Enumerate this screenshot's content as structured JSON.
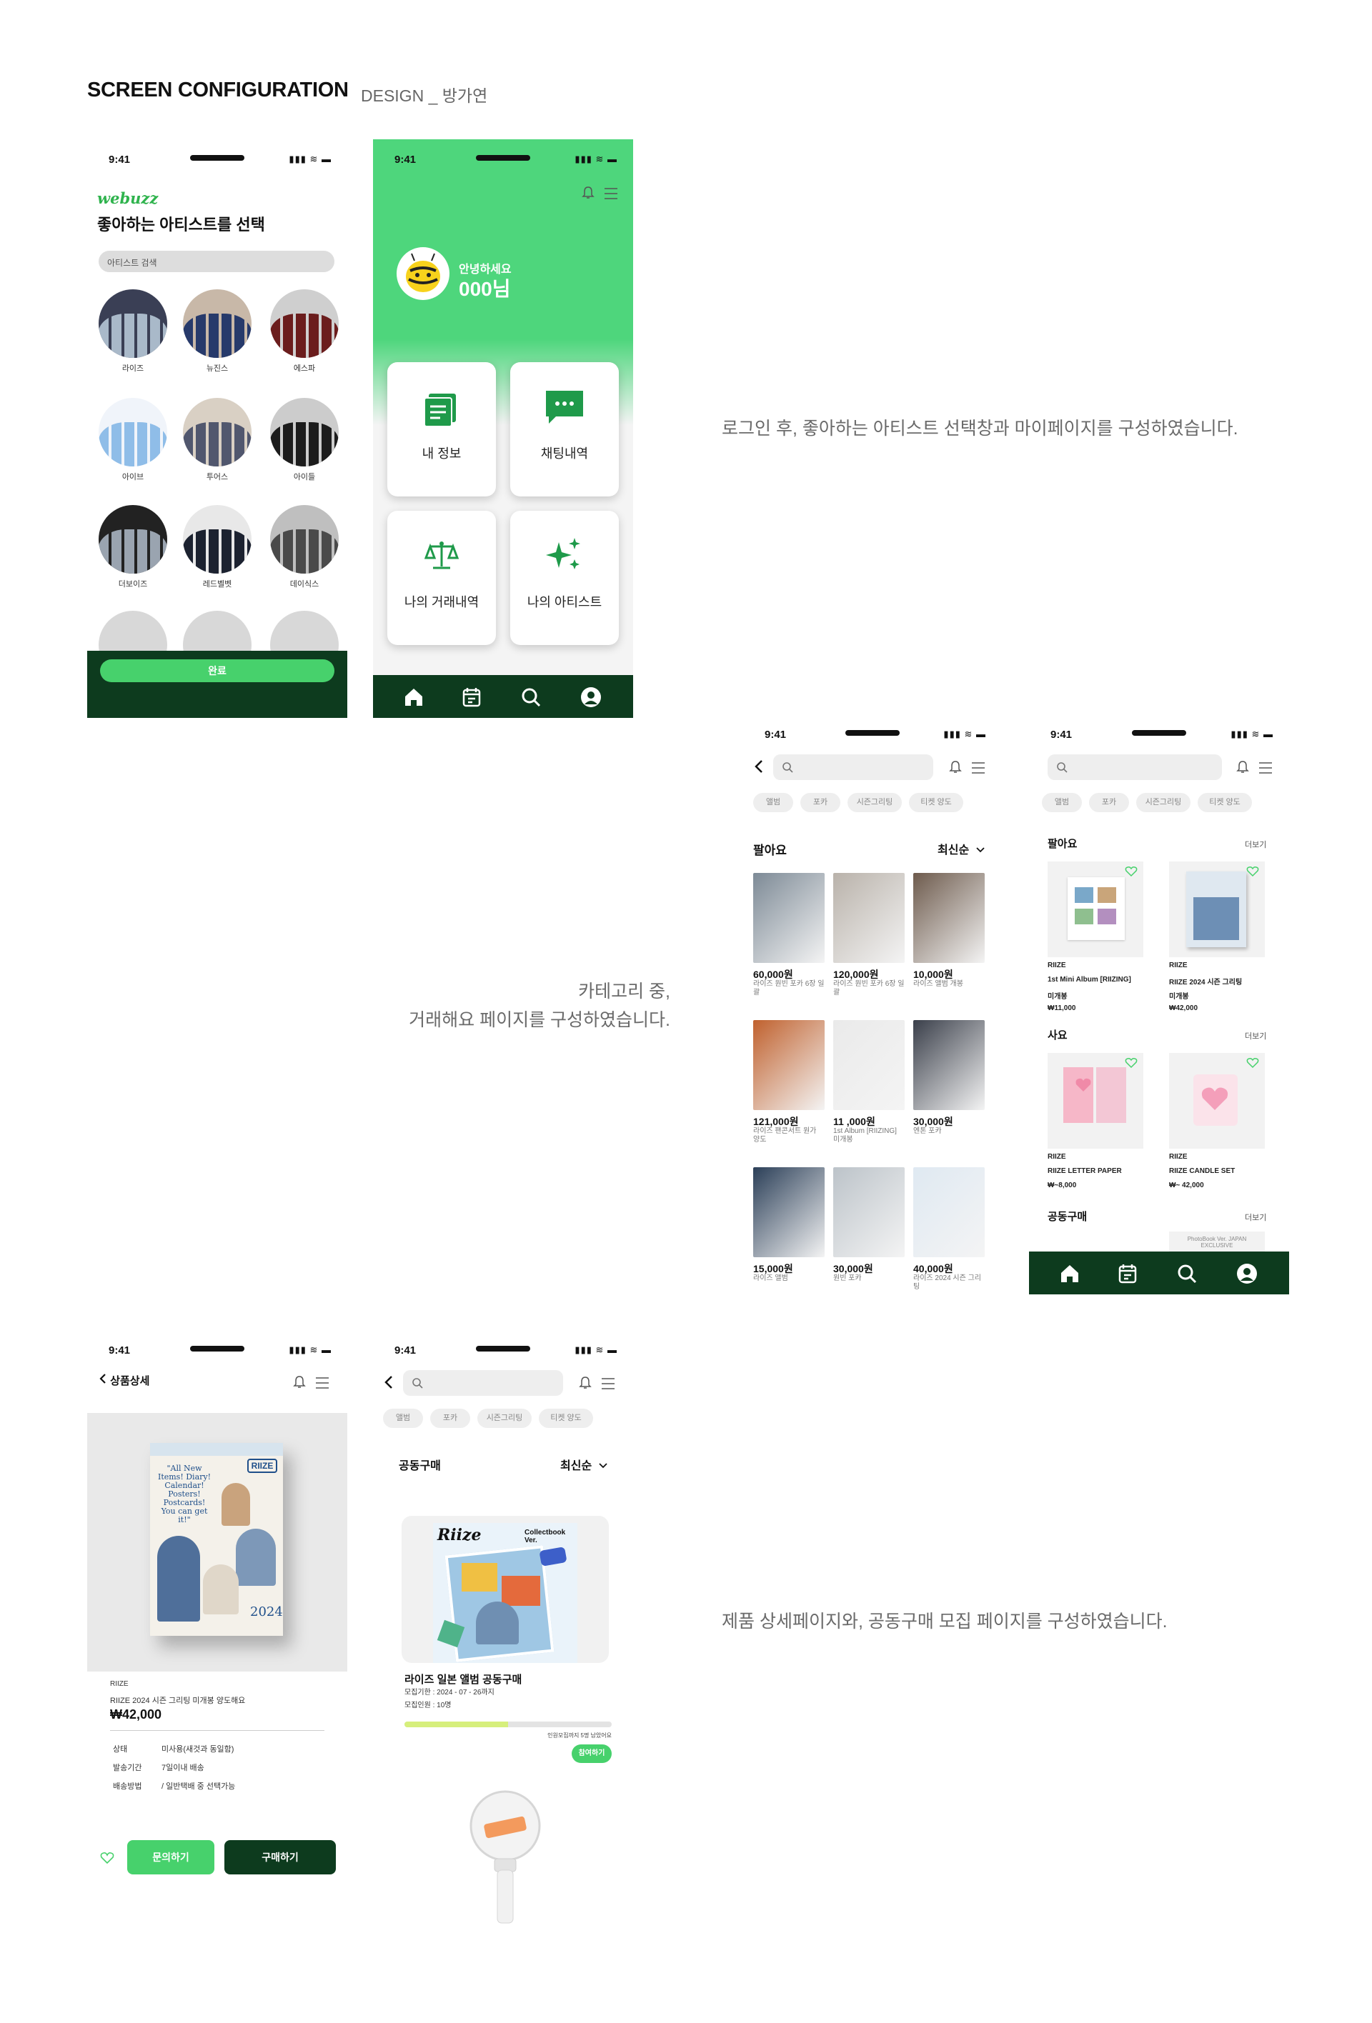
{
  "header": {
    "title": "SCREEN CONFIGURATION",
    "subtitle": "DESIGN _ 방가연"
  },
  "descriptions": {
    "d1": "로그인 후, 좋아하는 아티스트 선택창과 마이페이지를 구성하였습니다.",
    "d2a": "카테고리 중,",
    "d2b": "거래해요 페이지를 구성하였습니다.",
    "d3": "제품 상세페이지와, 공동구매 모집 페이지를 구성하였습니다."
  },
  "status": {
    "time": "9:41",
    "indicators": "▮▮▮ ≋ ▬"
  },
  "colors": {
    "green": "#47d16c",
    "dark": "#0d3b1e",
    "iconGreen": "#1f9a4a"
  },
  "select": {
    "logo": "webuzz",
    "title": "좋아하는 아티스트를 선택",
    "search_placeholder": "아티스트 검색",
    "artists": [
      "라이즈",
      "뉴진스",
      "에스파",
      "아이브",
      "투어스",
      "아이들",
      "더보이즈",
      "레드벨벳",
      "데이식스"
    ],
    "done": "완료"
  },
  "mypage": {
    "greeting": "안녕하세요",
    "name": "000님",
    "cards": [
      "내 정보",
      "채팅내역",
      "나의 거래내역",
      "나의 아티스트"
    ]
  },
  "categories": [
    "앨범",
    "포카",
    "시즌그리팅",
    "티켓 양도"
  ],
  "sell": {
    "title": "팔아요",
    "sort": "최신순",
    "items": [
      {
        "price": "60,000원",
        "desc": "라이즈 원빈 포카 6장 일괄"
      },
      {
        "price": "120,000원",
        "desc": "라이즈 원빈 포카 6장 일괄"
      },
      {
        "price": "10,000원",
        "desc": "라이즈 앨범 개봉"
      },
      {
        "price": "121,000원",
        "desc": "라이즈 팬콘서트 원가 양도"
      },
      {
        "price": "11 ,000원",
        "desc": "1st Album [RIIZING] 미개봉"
      },
      {
        "price": "30,000원",
        "desc": "엔톤 포카"
      },
      {
        "price": "15,000원",
        "desc": "라이즈 앨범"
      },
      {
        "price": "30,000원",
        "desc": "원빈 포카"
      },
      {
        "price": "40,000원",
        "desc": "라이즈 2024 시즌 그리팅"
      }
    ]
  },
  "home": {
    "sell_title": "팔아요",
    "more": "더보기",
    "sell_items": [
      {
        "brand": "RIIZE",
        "name": "1st Mini Album [RIIZING]",
        "state": "미개봉",
        "price": "₩11,000"
      },
      {
        "brand": "RIIZE",
        "name": "RIIZE 2024 시즌 그리팅",
        "state": "미개봉",
        "price": "₩42,000"
      }
    ],
    "buy_title": "사요",
    "buy_items": [
      {
        "brand": "RIIZE",
        "name": "RIIZE LETTER PAPER",
        "price": "₩~8,000"
      },
      {
        "brand": "RIIZE",
        "name": "RIIZE CANDLE SET",
        "price": "₩~ 42,000"
      }
    ],
    "group_title": "공동구매",
    "group_teaser": "PhotoBook Ver. JAPAN EXCLUSIVE"
  },
  "detail": {
    "back": "상품상세",
    "brand": "RIIZE",
    "name": "RIIZE 2024 시즌 그리팅 미개봉 양도해요",
    "price": "₩42,000",
    "rows": [
      {
        "k": "상태",
        "v": "미사용(새것과 동일함)"
      },
      {
        "k": "발송기간",
        "v": "7일이내 배송"
      },
      {
        "k": "배송방법",
        "v": "/ 일반택배 중 선택가능"
      }
    ],
    "cover_text": "\"All New Items! Diary! Calendar! Posters! Postcards! You can get it!\"",
    "cover_brand": "RIIZE",
    "cover_year": "2024",
    "ask": "문의하기",
    "buy": "구매하기"
  },
  "group": {
    "title": "공동구매",
    "sort": "최신순",
    "item_title": "라이즈 일본 앨범 공동구매",
    "period": "모집기한 : 2024 - 07 - 26까지",
    "people": "모집인원 : 10명",
    "remain": "인원모집까지 5명 남았어요",
    "join": "참여하기",
    "version": "Collectbook Ver.",
    "progress": 0.5
  }
}
